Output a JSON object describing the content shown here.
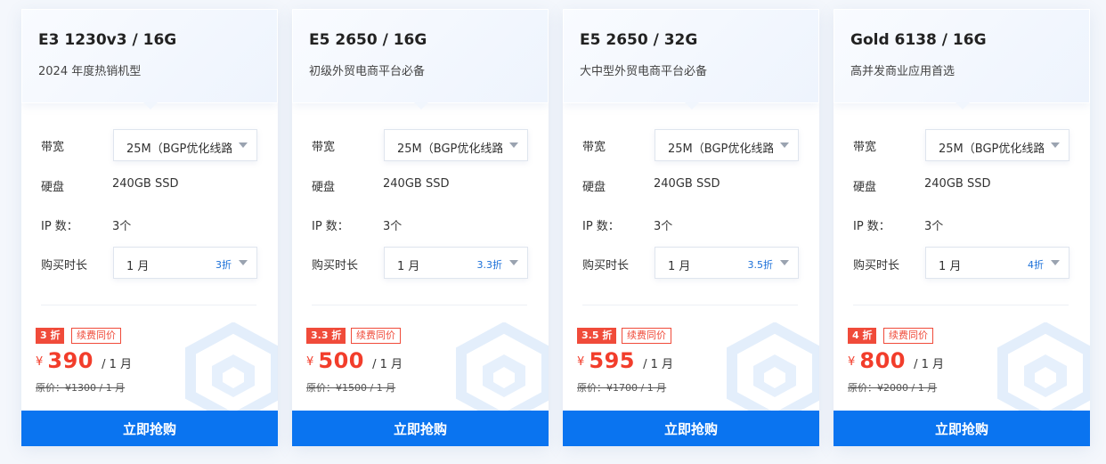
{
  "cards": [
    {
      "title": "E3 1230v3 / 16G",
      "subtitle": "2024 年度热销机型",
      "bandwidth_label": "带宽",
      "bandwidth_value": "25M（BGP优化线路）",
      "disk_label": "硬盘",
      "disk_value": "240GB SSD",
      "ip_label": "IP 数：",
      "ip_value": "3个",
      "duration_label": "购买时长",
      "duration_value": "1 月",
      "duration_discount": "3折",
      "badge": "3 折",
      "renew_tag": "续费同价",
      "currency": "¥",
      "price": "390",
      "price_unit": "/ 1 月",
      "original_price": "原价：¥1300 / 1 月",
      "buy_label": "立即抢购"
    },
    {
      "title": "E5 2650 / 16G",
      "subtitle": "初级外贸电商平台必备",
      "bandwidth_label": "带宽",
      "bandwidth_value": "25M（BGP优化线路）",
      "disk_label": "硬盘",
      "disk_value": "240GB SSD",
      "ip_label": "IP 数：",
      "ip_value": "3个",
      "duration_label": "购买时长",
      "duration_value": "1 月",
      "duration_discount": "3.3折",
      "badge": "3.3 折",
      "renew_tag": "续费同价",
      "currency": "¥",
      "price": "500",
      "price_unit": "/ 1 月",
      "original_price": "原价：¥1500 / 1 月",
      "buy_label": "立即抢购"
    },
    {
      "title": "E5 2650 / 32G",
      "subtitle": "大中型外贸电商平台必备",
      "bandwidth_label": "带宽",
      "bandwidth_value": "25M（BGP优化线路）",
      "disk_label": "硬盘",
      "disk_value": "240GB SSD",
      "ip_label": "IP 数：",
      "ip_value": "3个",
      "duration_label": "购买时长",
      "duration_value": "1 月",
      "duration_discount": "3.5折",
      "badge": "3.5 折",
      "renew_tag": "续费同价",
      "currency": "¥",
      "price": "595",
      "price_unit": "/ 1 月",
      "original_price": "原价：¥1700 / 1 月",
      "buy_label": "立即抢购"
    },
    {
      "title": "Gold 6138 / 16G",
      "subtitle": "高并发商业应用首选",
      "bandwidth_label": "带宽",
      "bandwidth_value": "25M（BGP优化线路）",
      "disk_label": "硬盘",
      "disk_value": "240GB SSD",
      "ip_label": "IP 数：",
      "ip_value": "3个",
      "duration_label": "购买时长",
      "duration_value": "1 月",
      "duration_discount": "4折",
      "badge": "4 折",
      "renew_tag": "续费同价",
      "currency": "¥",
      "price": "800",
      "price_unit": "/ 1 月",
      "original_price": "原价：¥2000 / 1 月",
      "buy_label": "立即抢购"
    }
  ],
  "icons": {
    "dropdown": "chevron-down-icon",
    "decoration": "hexagon-icon"
  },
  "colors": {
    "accent": "#0a74f0",
    "discount": "#f04b3a",
    "price": "#f23d2b"
  }
}
